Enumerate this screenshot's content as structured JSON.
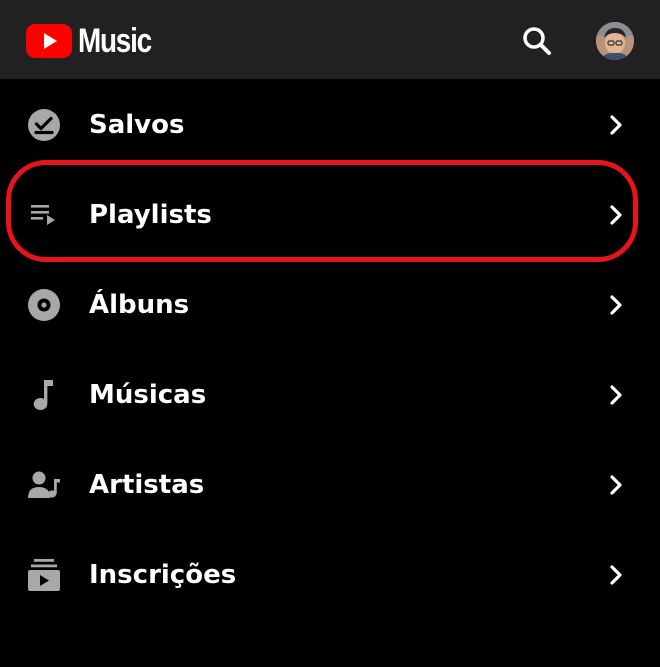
{
  "app": {
    "name": "Music",
    "brand_color": "#ff0000"
  },
  "header": {
    "search_icon": "search-icon",
    "avatar_icon": "account-avatar"
  },
  "menu": {
    "items": [
      {
        "label": "Salvos",
        "icon": "saved-check-icon"
      },
      {
        "label": "Playlists",
        "icon": "playlist-icon"
      },
      {
        "label": "Álbuns",
        "icon": "album-disc-icon"
      },
      {
        "label": "Músicas",
        "icon": "music-note-icon"
      },
      {
        "label": "Artistas",
        "icon": "artist-icon"
      },
      {
        "label": "Inscrições",
        "icon": "subscriptions-icon"
      }
    ],
    "highlighted_item": "Playlists",
    "highlight_color": "#e8141c"
  }
}
